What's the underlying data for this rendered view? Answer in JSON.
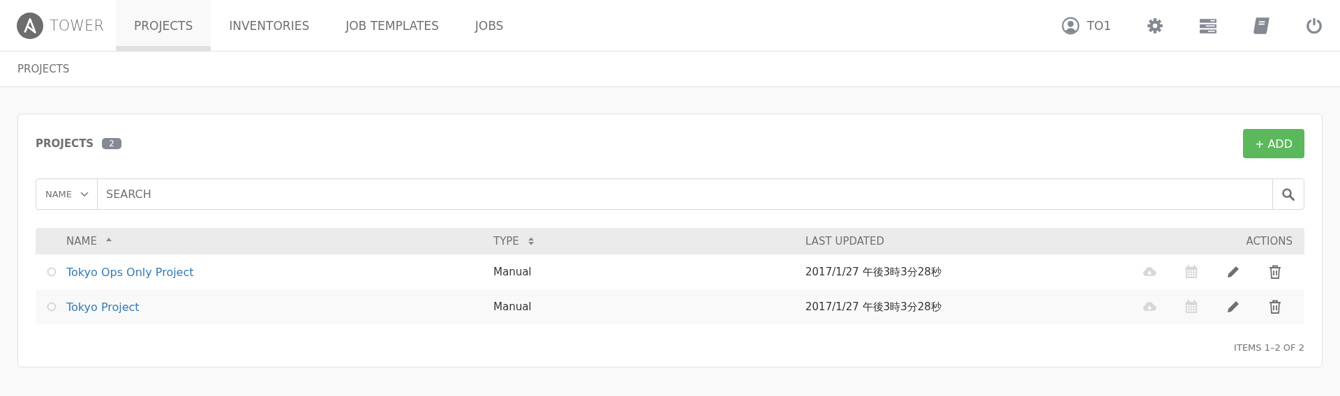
{
  "brand": "TOWER",
  "nav": [
    {
      "label": "PROJECTS",
      "selected": true
    },
    {
      "label": "INVENTORIES",
      "selected": false
    },
    {
      "label": "JOB TEMPLATES",
      "selected": false
    },
    {
      "label": "JOBS",
      "selected": false
    }
  ],
  "user": "TO1",
  "breadcrumb": "PROJECTS",
  "panel": {
    "title": "PROJECTS",
    "count": "2",
    "add_button": "+ ADD",
    "search": {
      "field": "NAME",
      "placeholder": "SEARCH"
    },
    "columns": [
      {
        "label": "NAME",
        "sortable": true,
        "sorted": true
      },
      {
        "label": "TYPE",
        "sortable": true,
        "sorted": false
      },
      {
        "label": "LAST UPDATED"
      },
      {
        "label": "ACTIONS"
      }
    ],
    "rows": [
      {
        "name": "Tokyo Ops Only Project",
        "type": "Manual",
        "updated": "2017/1/27 午後3時3分28秒",
        "actions": [
          {
            "kind": "sync",
            "disabled": true
          },
          {
            "kind": "schedule",
            "disabled": true
          },
          {
            "kind": "edit",
            "disabled": false
          },
          {
            "kind": "delete",
            "disabled": false
          }
        ]
      },
      {
        "name": "Tokyo Project",
        "type": "Manual",
        "updated": "2017/1/27 午後3時3分28秒",
        "actions": [
          {
            "kind": "sync",
            "disabled": true
          },
          {
            "kind": "schedule",
            "disabled": true
          },
          {
            "kind": "edit",
            "disabled": false
          },
          {
            "kind": "delete",
            "disabled": false
          }
        ]
      }
    ],
    "pagination": "ITEMS 1–2 OF 2"
  }
}
